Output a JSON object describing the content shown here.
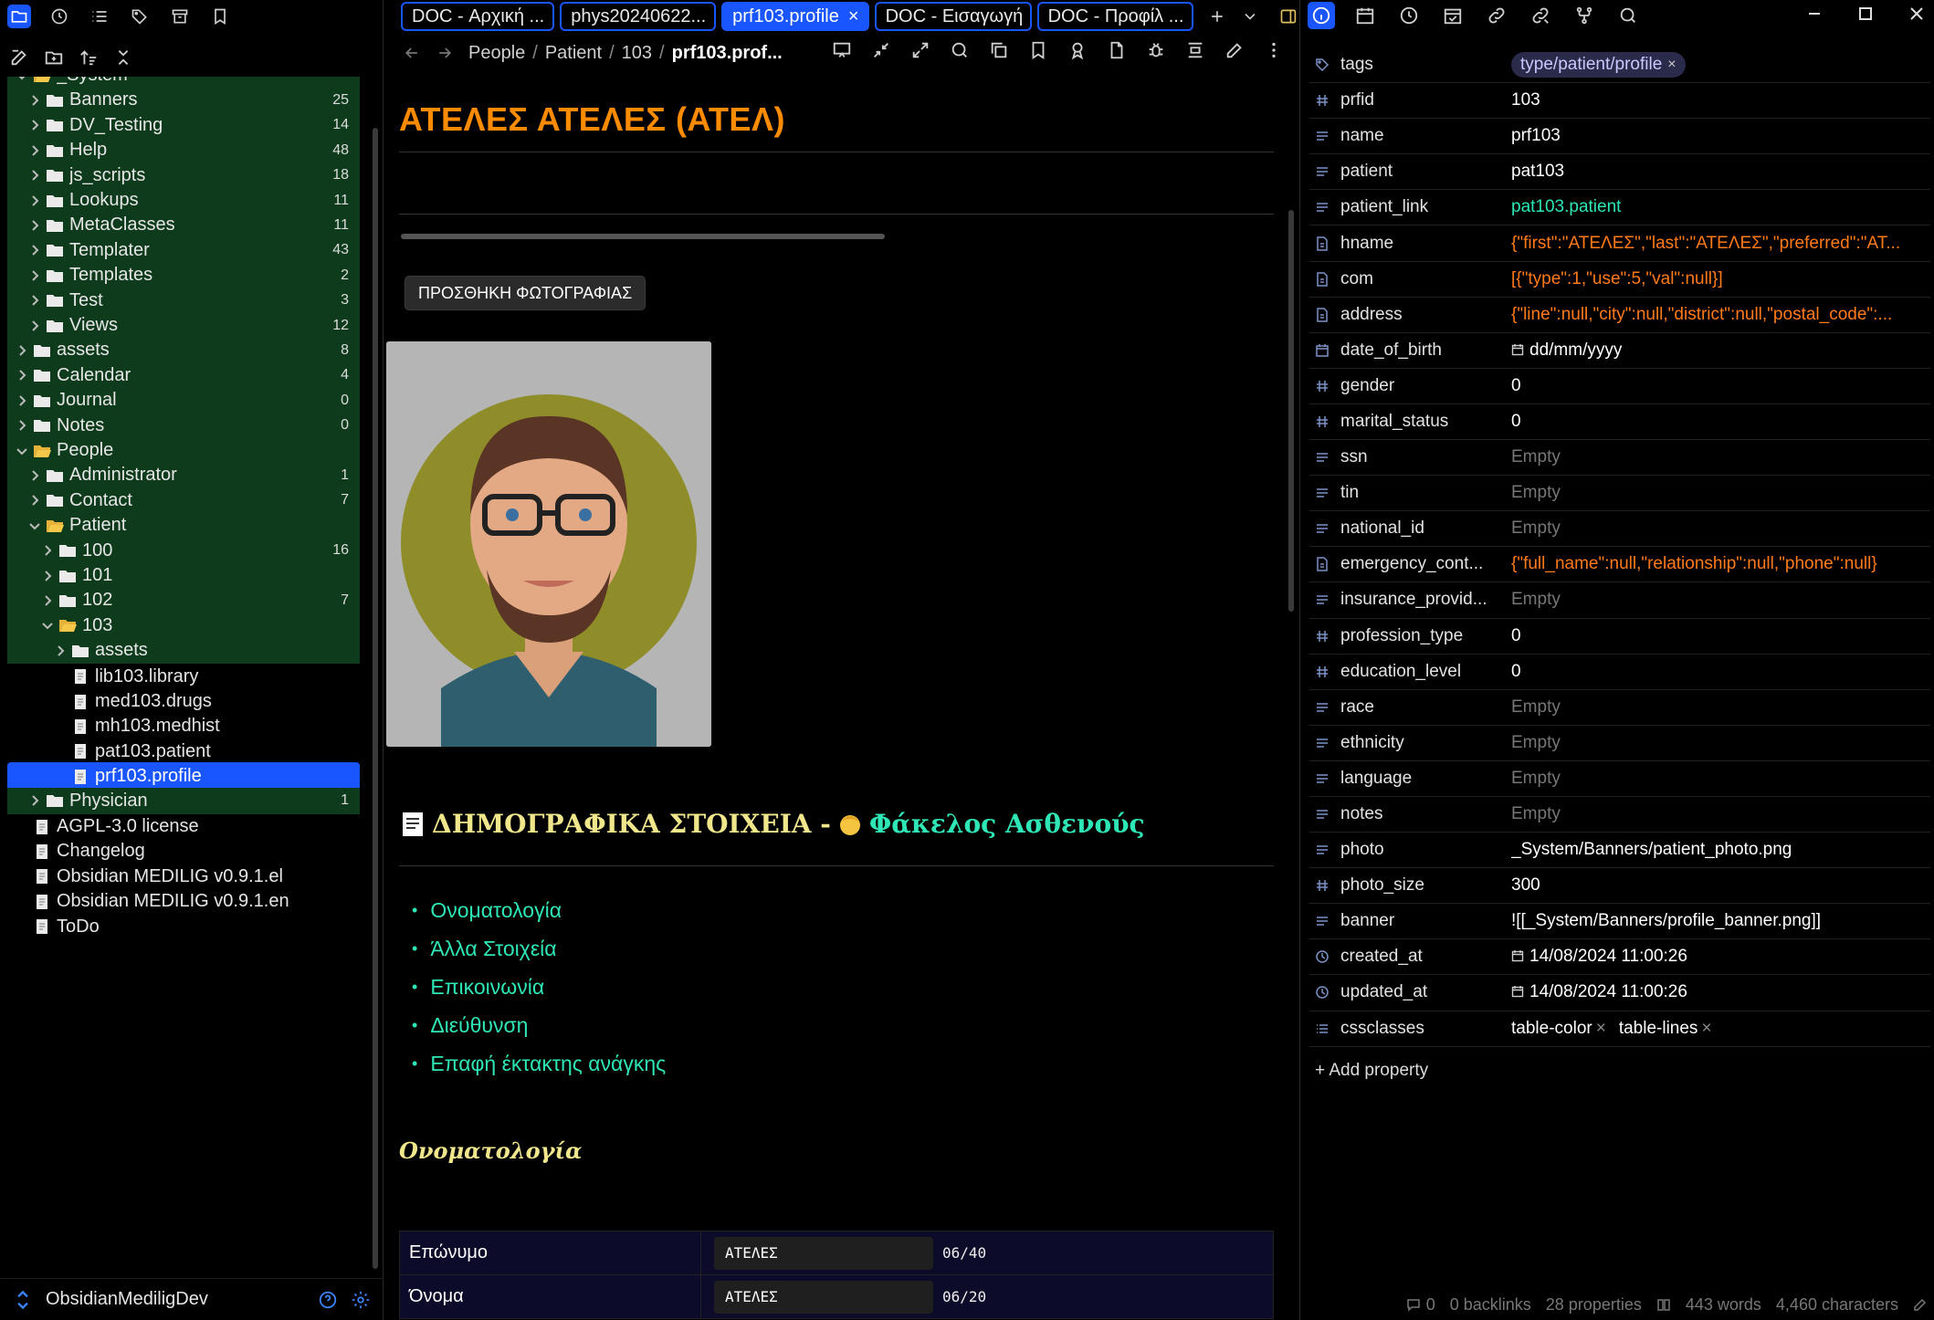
{
  "left": {
    "vault_name": "ObsidianMediligDev",
    "tree": [
      {
        "label": "_System",
        "type": "folder",
        "open": true,
        "depth": 1,
        "count": ""
      },
      {
        "label": "Banners",
        "type": "folder",
        "depth": 2,
        "count": "25"
      },
      {
        "label": "DV_Testing",
        "type": "folder",
        "depth": 2,
        "count": "14"
      },
      {
        "label": "Help",
        "type": "folder",
        "depth": 2,
        "count": "48"
      },
      {
        "label": "js_scripts",
        "type": "folder",
        "depth": 2,
        "count": "18"
      },
      {
        "label": "Lookups",
        "type": "folder",
        "depth": 2,
        "count": "11"
      },
      {
        "label": "MetaClasses",
        "type": "folder",
        "depth": 2,
        "count": "11"
      },
      {
        "label": "Templater",
        "type": "folder",
        "depth": 2,
        "count": "43"
      },
      {
        "label": "Templates",
        "type": "folder",
        "depth": 2,
        "count": "2"
      },
      {
        "label": "Test",
        "type": "folder",
        "depth": 2,
        "count": "3"
      },
      {
        "label": "Views",
        "type": "folder",
        "depth": 2,
        "count": "12"
      },
      {
        "label": "assets",
        "type": "folder",
        "depth": 1,
        "count": "8"
      },
      {
        "label": "Calendar",
        "type": "folder",
        "depth": 1,
        "count": "4"
      },
      {
        "label": "Journal",
        "type": "folder",
        "depth": 1,
        "count": "0"
      },
      {
        "label": "Notes",
        "type": "folder",
        "depth": 1,
        "count": "0"
      },
      {
        "label": "People",
        "type": "folder",
        "open": true,
        "depth": 1,
        "count": ""
      },
      {
        "label": "Administrator",
        "type": "folder",
        "depth": 2,
        "count": "1"
      },
      {
        "label": "Contact",
        "type": "folder",
        "depth": 2,
        "count": "7"
      },
      {
        "label": "Patient",
        "type": "folder",
        "open": true,
        "depth": 2,
        "count": ""
      },
      {
        "label": "100",
        "type": "folder",
        "depth": 3,
        "count": "16"
      },
      {
        "label": "101",
        "type": "folder",
        "depth": 3,
        "count": ""
      },
      {
        "label": "102",
        "type": "folder",
        "depth": 3,
        "count": "7"
      },
      {
        "label": "103",
        "type": "folder",
        "open": true,
        "depth": 3,
        "count": ""
      },
      {
        "label": "assets",
        "type": "folder",
        "depth": 4,
        "count": ""
      },
      {
        "label": "lib103.library",
        "type": "file",
        "depth": 4,
        "count": ""
      },
      {
        "label": "med103.drugs",
        "type": "file",
        "depth": 4,
        "count": ""
      },
      {
        "label": "mh103.medhist",
        "type": "file",
        "depth": 4,
        "count": ""
      },
      {
        "label": "pat103.patient",
        "type": "file",
        "depth": 4,
        "count": ""
      },
      {
        "label": "prf103.profile",
        "type": "file",
        "depth": 4,
        "count": "",
        "selected": true
      },
      {
        "label": "Physician",
        "type": "folder",
        "depth": 2,
        "count": "1"
      },
      {
        "label": "AGPL-3.0 license",
        "type": "file",
        "depth": 1,
        "count": ""
      },
      {
        "label": "Changelog",
        "type": "file",
        "depth": 1,
        "count": ""
      },
      {
        "label": "Obsidian MEDILIG v0.9.1.el",
        "type": "file",
        "depth": 1,
        "count": ""
      },
      {
        "label": "Obsidian MEDILIG v0.9.1.en",
        "type": "file",
        "depth": 1,
        "count": ""
      },
      {
        "label": "ToDo",
        "type": "file",
        "depth": 1,
        "count": ""
      }
    ]
  },
  "tabs": [
    {
      "label": "DOC - Αρχική ...",
      "active": false
    },
    {
      "label": "phys20240622...",
      "active": false
    },
    {
      "label": "prf103.profile",
      "active": true
    },
    {
      "label": "DOC - Εισαγωγή",
      "active": false
    },
    {
      "label": "DOC - Προφίλ ...",
      "active": false
    }
  ],
  "breadcrumb": {
    "p1": "People",
    "p2": "Patient",
    "p3": "103",
    "current": "prf103.prof..."
  },
  "note": {
    "title": "ΑΤΕΛΕΣ ΑΤΕΛΕΣ (ΑΤΕΛ)",
    "add_photo_label": "ΠΡΟΣΘΗΚΗ ΦΩΤΟΓΡΑΦΙΑΣ",
    "section_part1": "ΔΗΜΟΓΡΑΦΙΚΑ ΣΤΟΙΧΕΙΑ -",
    "section_part2": "Φάκελος Ασθενούς",
    "toc": [
      "Ονοματολογία",
      "Άλλα Στοιχεία",
      "Επικοινωνία",
      "Διεύθυνση",
      "Επαφή έκτακτης ανάγκης"
    ],
    "subsection": "Ονοματολογία",
    "fields": [
      {
        "label": "Επώνυμο",
        "value": "ΑΤΕΛΕΣ",
        "count": "06/40"
      },
      {
        "label": "Όνομα",
        "value": "ΑΤΕΛΕΣ",
        "count": "06/20"
      }
    ]
  },
  "properties": [
    {
      "name": "tags",
      "icon": "tags-icon",
      "kind": "pill",
      "value": "type/patient/profile"
    },
    {
      "name": "prfid",
      "icon": "number-icon",
      "kind": "text",
      "value": "103"
    },
    {
      "name": "name",
      "icon": "text-icon",
      "kind": "text",
      "value": "prf103"
    },
    {
      "name": "patient",
      "icon": "text-icon",
      "kind": "text",
      "value": "pat103"
    },
    {
      "name": "patient_link",
      "icon": "text-icon",
      "kind": "link",
      "value": "pat103.patient"
    },
    {
      "name": "hname",
      "icon": "object-icon",
      "kind": "json",
      "value": "{\"first\":\"ΑΤΕΛΕΣ\",\"last\":\"ΑΤΕΛΕΣ\",\"preferred\":\"AT..."
    },
    {
      "name": "com",
      "icon": "object-icon",
      "kind": "json",
      "value": "[{\"type\":1,\"use\":5,\"val\":null}]"
    },
    {
      "name": "address",
      "icon": "object-icon",
      "kind": "json",
      "value": "{\"line\":null,\"city\":null,\"district\":null,\"postal_code\":..."
    },
    {
      "name": "date_of_birth",
      "icon": "calendar-icon",
      "kind": "date",
      "value": "dd/mm/yyyy"
    },
    {
      "name": "gender",
      "icon": "number-icon",
      "kind": "text",
      "value": "0"
    },
    {
      "name": "marital_status",
      "icon": "number-icon",
      "kind": "text",
      "value": "0"
    },
    {
      "name": "ssn",
      "icon": "text-icon",
      "kind": "empty",
      "value": "Empty"
    },
    {
      "name": "tin",
      "icon": "text-icon",
      "kind": "empty",
      "value": "Empty"
    },
    {
      "name": "national_id",
      "icon": "text-icon",
      "kind": "empty",
      "value": "Empty"
    },
    {
      "name": "emergency_cont...",
      "icon": "object-icon",
      "kind": "json",
      "value": "{\"full_name\":null,\"relationship\":null,\"phone\":null}"
    },
    {
      "name": "insurance_provid...",
      "icon": "text-icon",
      "kind": "empty",
      "value": "Empty"
    },
    {
      "name": "profession_type",
      "icon": "number-icon",
      "kind": "text",
      "value": "0"
    },
    {
      "name": "education_level",
      "icon": "number-icon",
      "kind": "text",
      "value": "0"
    },
    {
      "name": "race",
      "icon": "text-icon",
      "kind": "empty",
      "value": "Empty"
    },
    {
      "name": "ethnicity",
      "icon": "text-icon",
      "kind": "empty",
      "value": "Empty"
    },
    {
      "name": "language",
      "icon": "text-icon",
      "kind": "empty",
      "value": "Empty"
    },
    {
      "name": "notes",
      "icon": "text-icon",
      "kind": "empty",
      "value": "Empty"
    },
    {
      "name": "photo",
      "icon": "text-icon",
      "kind": "text",
      "value": "_System/Banners/patient_photo.png"
    },
    {
      "name": "photo_size",
      "icon": "number-icon",
      "kind": "text",
      "value": "300"
    },
    {
      "name": "banner",
      "icon": "text-icon",
      "kind": "text",
      "value": "![[_System/Banners/profile_banner.png]]"
    },
    {
      "name": "created_at",
      "icon": "clock-icon",
      "kind": "date",
      "value": "14/08/2024 11:00:26"
    },
    {
      "name": "updated_at",
      "icon": "clock-icon",
      "kind": "date",
      "value": "14/08/2024 11:00:26"
    },
    {
      "name": "cssclasses",
      "icon": "list-icon",
      "kind": "classes",
      "values": [
        "table-color",
        "table-lines"
      ]
    }
  ],
  "add_property_label": "+ Add property",
  "status": {
    "comments": "0",
    "backlinks": "0 backlinks",
    "properties": "28 properties",
    "words": "443 words",
    "characters": "4,460 characters"
  },
  "colors": {
    "accent": "#1a56ff",
    "folder_row": "#0e3b1c",
    "title": "#ff8c00",
    "link": "#2ee6b6",
    "json": "#ff7b1a"
  }
}
